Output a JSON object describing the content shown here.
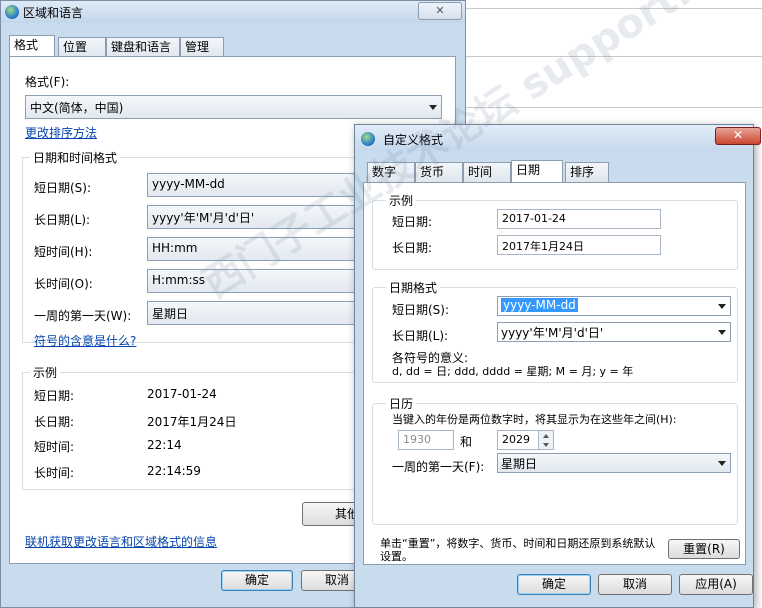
{
  "region_dialog": {
    "title": "区域和语言",
    "close_label": "✕",
    "tabs": [
      "格式",
      "位置",
      "键盘和语言",
      "管理"
    ],
    "format_label": "格式(F):",
    "format_value": "中文(简体，中国)",
    "sort_link": "更改排序方法",
    "datetime_group": "日期和时间格式",
    "rows": [
      {
        "label": "短日期(S):",
        "value": "yyyy-MM-dd"
      },
      {
        "label": "长日期(L):",
        "value": "yyyy'年'M'月'd'日'"
      },
      {
        "label": "短时间(H):",
        "value": "HH:mm"
      },
      {
        "label": "长时间(O):",
        "value": "H:mm:ss"
      },
      {
        "label": "一周的第一天(W):",
        "value": "星期日"
      }
    ],
    "symbols_link": "符号的含意是什么?",
    "example_group": "示例",
    "examples": [
      {
        "label": "短日期:",
        "value": "2017-01-24"
      },
      {
        "label": "长日期:",
        "value": "2017年1月24日"
      },
      {
        "label": "短时间:",
        "value": "22:14"
      },
      {
        "label": "长时间:",
        "value": "22:14:59"
      }
    ],
    "other_settings_label": "其他",
    "online_link": "联机获取更改语言和区域格式的信息",
    "ok_label": "确定",
    "cancel_label": "取消"
  },
  "custom_dialog": {
    "title": "自定义格式",
    "close_label": "✕",
    "tabs": [
      "数字",
      "货币",
      "时间",
      "日期",
      "排序"
    ],
    "example_group": "示例",
    "example_short_label": "短日期:",
    "example_short_value": "2017-01-24",
    "example_long_label": "长日期:",
    "example_long_value": "2017年1月24日",
    "format_group": "日期格式",
    "short_label": "短日期(S):",
    "short_value": "yyyy-MM-dd",
    "long_label": "长日期(L):",
    "long_value": "yyyy'年'M'月'd'日'",
    "meaning_label": "各符号的意义:",
    "meaning_text": "d, dd = 日;  ddd, dddd = 星期;  M = 月;  y = 年",
    "calendar_group": "日历",
    "calendar_desc": "当键入的年份是两位数字时，将其显示为在这些年之间(H):",
    "year_from": "1930",
    "and_label": "和",
    "year_to": "2029",
    "first_day_label": "一周的第一天(F):",
    "first_day_value": "星期日",
    "reset_desc": "单击“重置”，将数字、货币、时间和日期还原到系统默认设置。",
    "reset_label": "重置(R)",
    "ok_label": "确定",
    "cancel_label": "取消",
    "apply_label": "应用(A)"
  },
  "watermark": "西门子工业技术论坛 support.industry.siemens.com/cs"
}
